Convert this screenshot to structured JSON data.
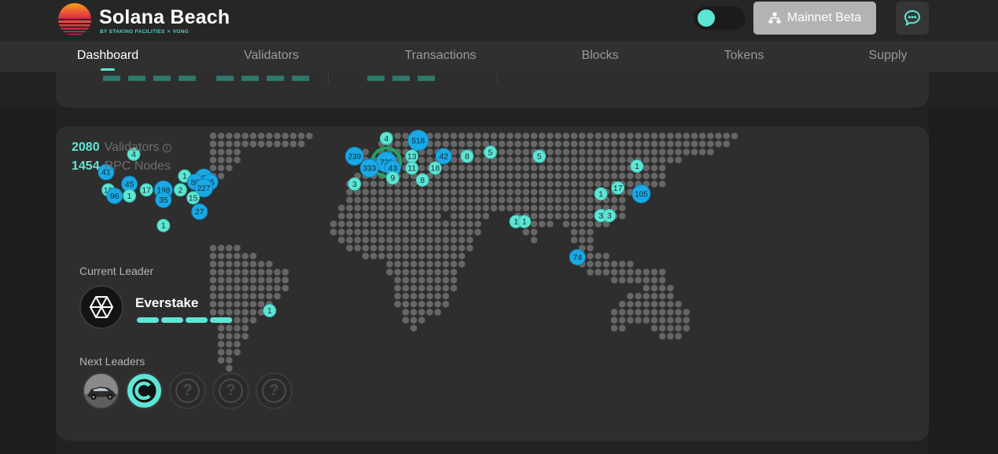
{
  "brand": {
    "name": "Solana Beach",
    "subtitle": "BY STAKING FACILITIES ✕ VGNG",
    "logo_icon": "sunset-logo-icon"
  },
  "header": {
    "theme_toggle_on": true,
    "network_label": "Mainnet Beta",
    "network_icon": "network-icon",
    "chat_icon": "chat-icon"
  },
  "nav": {
    "items": [
      {
        "label": "Dashboard",
        "active": true
      },
      {
        "label": "Validators",
        "active": false
      },
      {
        "label": "Transactions",
        "active": false
      },
      {
        "label": "Blocks",
        "active": false
      },
      {
        "label": "Tokens",
        "active": false
      },
      {
        "label": "Supply",
        "active": false
      }
    ]
  },
  "stats": {
    "validators_count": "2080",
    "validators_label": "Validators",
    "rpc_count": "1454",
    "rpc_label": "RPC Nodes"
  },
  "leader": {
    "current_label": "Current Leader",
    "current_name": "Everstake",
    "current_icon": "everstake-logo-icon",
    "slots_done": 4,
    "slots_total": 4,
    "next_label": "Next Leaders",
    "next": [
      {
        "icon": "car-photo-avatar"
      },
      {
        "icon": "c-logo-avatar"
      },
      {
        "icon": "unknown-avatar",
        "text": "?"
      },
      {
        "icon": "unknown-avatar",
        "text": "?"
      },
      {
        "icon": "unknown-avatar",
        "text": "?"
      }
    ]
  },
  "clusters": [
    {
      "label": "4",
      "lon": -110,
      "lat": 55
    },
    {
      "label": "41",
      "lon": -123,
      "lat": 46
    },
    {
      "label": "1",
      "lon": -86,
      "lat": 44
    },
    {
      "label": "101",
      "lon": -77,
      "lat": 43
    },
    {
      "label": "45",
      "lon": -112,
      "lat": 40
    },
    {
      "label": "86",
      "lon": -81,
      "lat": 41
    },
    {
      "label": "25",
      "lon": -74,
      "lat": 41
    },
    {
      "label": "18",
      "lon": -122,
      "lat": 37
    },
    {
      "label": "17",
      "lon": -104,
      "lat": 37
    },
    {
      "label": "198",
      "lon": -96,
      "lat": 37
    },
    {
      "label": "2",
      "lon": -88,
      "lat": 37
    },
    {
      "label": "227",
      "lon": -77,
      "lat": 38
    },
    {
      "label": "96",
      "lon": -119,
      "lat": 34
    },
    {
      "label": "1",
      "lon": -112,
      "lat": 34
    },
    {
      "label": "35",
      "lon": -96,
      "lat": 32
    },
    {
      "label": "15",
      "lon": -82,
      "lat": 33
    },
    {
      "label": "27",
      "lon": -79,
      "lat": 26
    },
    {
      "label": "1",
      "lon": -96,
      "lat": 19
    },
    {
      "label": "1",
      "lon": -46,
      "lat": -24
    },
    {
      "label": "4",
      "lon": 9,
      "lat": 63
    },
    {
      "label": "518",
      "lon": 24,
      "lat": 62
    },
    {
      "label": "239",
      "lon": -6,
      "lat": 54
    },
    {
      "label": "723",
      "lon": 9,
      "lat": 51
    },
    {
      "label": "13",
      "lon": 21,
      "lat": 54
    },
    {
      "label": "42",
      "lon": 36,
      "lat": 54
    },
    {
      "label": "8",
      "lon": 47,
      "lat": 54
    },
    {
      "label": "5",
      "lon": 58,
      "lat": 56
    },
    {
      "label": "5",
      "lon": 81,
      "lat": 54
    },
    {
      "label": "333",
      "lon": 1,
      "lat": 48
    },
    {
      "label": "43",
      "lon": 12,
      "lat": 48
    },
    {
      "label": "11",
      "lon": 21,
      "lat": 48
    },
    {
      "label": "18",
      "lon": 32,
      "lat": 48
    },
    {
      "label": "9",
      "lon": 12,
      "lat": 43
    },
    {
      "label": "8",
      "lon": 26,
      "lat": 42
    },
    {
      "label": "3",
      "lon": -6,
      "lat": 40
    },
    {
      "label": "1",
      "lon": 127,
      "lat": 49
    },
    {
      "label": "17",
      "lon": 118,
      "lat": 38
    },
    {
      "label": "1",
      "lon": 110,
      "lat": 35
    },
    {
      "label": "105",
      "lon": 129,
      "lat": 35
    },
    {
      "label": "3",
      "lon": 110,
      "lat": 24
    },
    {
      "label": "3",
      "lon": 114,
      "lat": 24
    },
    {
      "label": "1",
      "lon": 70,
      "lat": 21
    },
    {
      "label": "1",
      "lon": 74,
      "lat": 21
    },
    {
      "label": "74",
      "lon": 99,
      "lat": 3
    }
  ]
}
